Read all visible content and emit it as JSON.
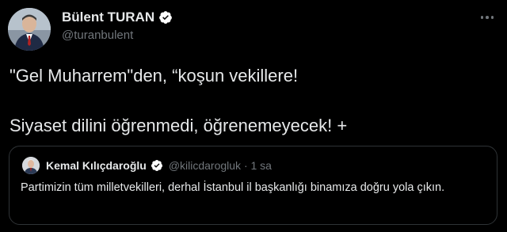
{
  "author": {
    "name": "Bülent TURAN",
    "handle": "@turanbulent",
    "verified": true
  },
  "tweet": {
    "line1": "\"Gel Muharrem\"den, “koşun vekillere!",
    "line2": "Siyaset dilini öğrenmedi, öğrenemeyecek! +"
  },
  "quoted": {
    "name": "Kemal Kılıçdaroğlu",
    "meta": "@kilicdarogluk · 1 sa",
    "text": "Partimizin tüm milletvekilleri, derhal İstanbul il başkanlığı binamıza doğru yola çıkın.",
    "verified": true
  },
  "colors": {
    "background": "#000000",
    "text": "#e7e9ea",
    "secondary": "#71767b",
    "border": "#2f3336",
    "verified_badge": "#ffffff"
  },
  "icons": {
    "more": "ellipsis-icon",
    "verified": "verified-badge-icon"
  }
}
